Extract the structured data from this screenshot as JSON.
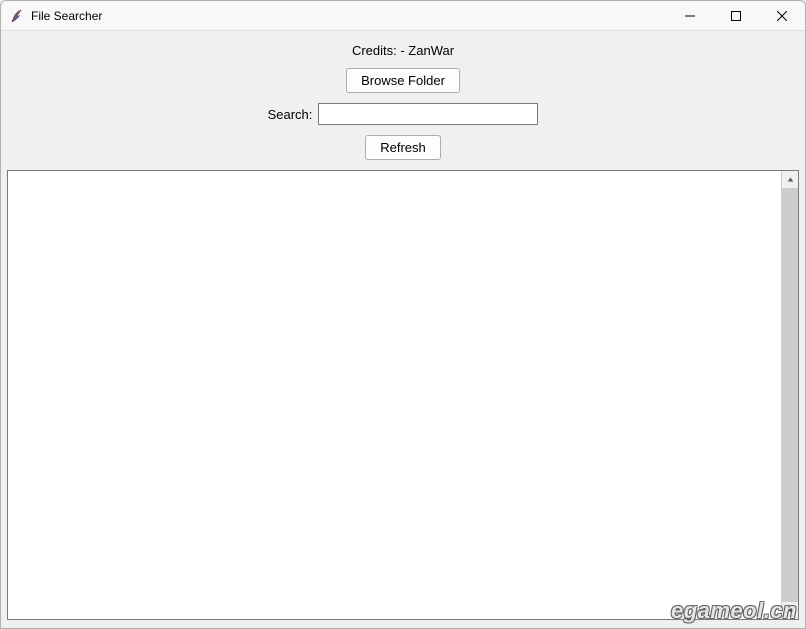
{
  "window": {
    "title": "File Searcher"
  },
  "credits": "Credits: - ZanWar",
  "buttons": {
    "browse": "Browse Folder",
    "refresh": "Refresh"
  },
  "search": {
    "label": "Search:",
    "value": ""
  },
  "listbox": {
    "items": []
  },
  "watermark": "egameol.cn"
}
